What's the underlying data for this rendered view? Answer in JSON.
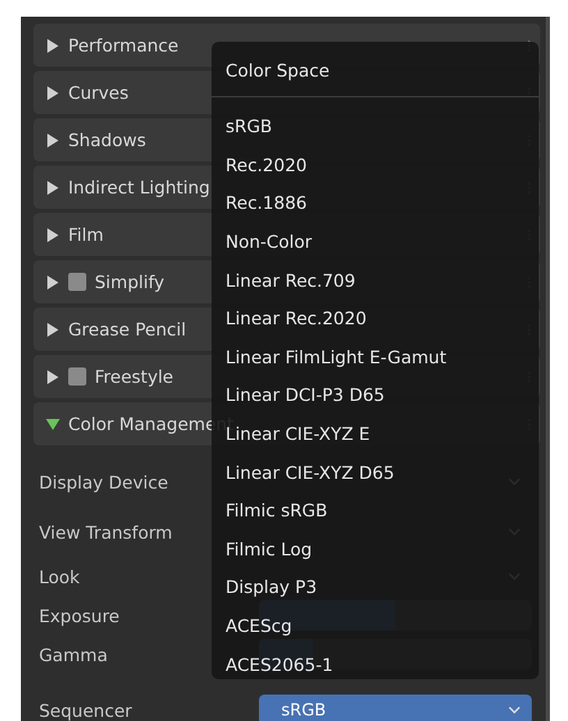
{
  "panels": [
    {
      "label": "Performance",
      "kind": "plain",
      "expanded": false
    },
    {
      "label": "Curves",
      "kind": "plain",
      "expanded": false
    },
    {
      "label": "Shadows",
      "kind": "plain",
      "expanded": false
    },
    {
      "label": "Indirect Lighting",
      "kind": "plain",
      "expanded": false
    },
    {
      "label": "Film",
      "kind": "plain",
      "expanded": false
    },
    {
      "label": "Simplify",
      "kind": "checkbox",
      "checked": false,
      "expanded": false
    },
    {
      "label": "Grease Pencil",
      "kind": "plain",
      "expanded": false
    },
    {
      "label": "Freestyle",
      "kind": "checkbox",
      "checked": false,
      "expanded": false
    },
    {
      "label": "Color Management",
      "kind": "plain",
      "expanded": true
    }
  ],
  "properties": [
    {
      "label": "Display Device",
      "kind": "dropdown"
    },
    {
      "label": "View Transform",
      "kind": "dropdown"
    },
    {
      "label": "Look",
      "kind": "dropdown"
    },
    {
      "label": "Exposure",
      "kind": "slider",
      "level": 0.5
    },
    {
      "label": "Gamma",
      "kind": "slider",
      "level": 0.2
    }
  ],
  "sequencer": {
    "label": "Sequencer",
    "value": "sRGB",
    "open": true
  },
  "menu": {
    "title": "Color Space",
    "items": [
      "sRGB",
      "Rec.2020",
      "Rec.1886",
      "Non-Color",
      "Linear Rec.709",
      "Linear Rec.2020",
      "Linear FilmLight E-Gamut",
      "Linear DCI-P3 D65",
      "Linear CIE-XYZ E",
      "Linear CIE-XYZ D65",
      "Filmic sRGB",
      "Filmic Log",
      "Display P3",
      "ACEScg",
      "ACES2065-1"
    ]
  }
}
